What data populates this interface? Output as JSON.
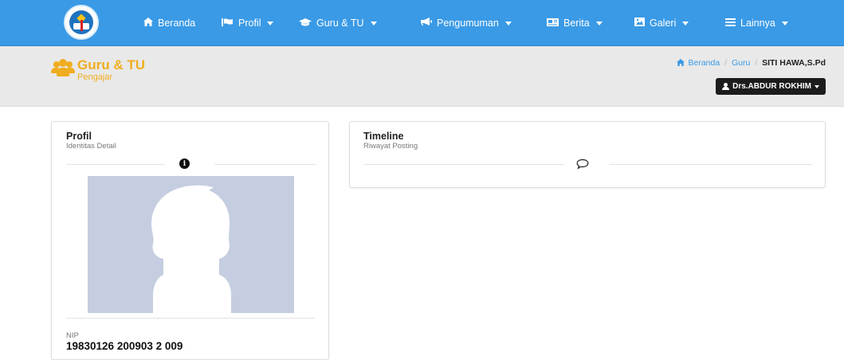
{
  "nav": {
    "items": [
      {
        "label": "Beranda",
        "icon": "home-icon",
        "has_caret": false
      },
      {
        "label": "Profil",
        "icon": "flag-icon",
        "has_caret": true
      },
      {
        "label": "Guru & TU",
        "icon": "graduation-cap-icon",
        "has_caret": true
      },
      {
        "label": "Pengumuman",
        "icon": "bullhorn-icon",
        "has_caret": true
      },
      {
        "label": "Berita",
        "icon": "newspaper-icon",
        "has_caret": true
      },
      {
        "label": "Galeri",
        "icon": "image-icon",
        "has_caret": true
      },
      {
        "label": "Lainnya",
        "icon": "list-icon",
        "has_caret": true
      }
    ],
    "color": "#3a9ae6"
  },
  "header": {
    "title": "Guru & TU",
    "subtitle": "Pengajar",
    "accent_color": "#f0ad1f",
    "breadcrumb": {
      "home": "Beranda",
      "section": "Guru",
      "current": "SITI HAWA,S.Pd"
    },
    "user_button": "Drs.ABDUR ROKHIM"
  },
  "profile": {
    "title": "Profil",
    "subtitle": "Identitas Detail",
    "nip_label": "NIP",
    "nip_value": "19830126 200903 2 009"
  },
  "timeline": {
    "title": "Timeline",
    "subtitle": "Riwayat Posting"
  }
}
